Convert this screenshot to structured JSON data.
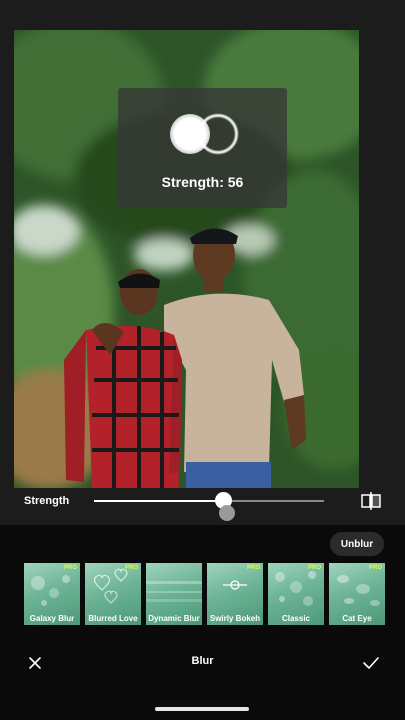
{
  "popup": {
    "strength_text": "Strength: 56"
  },
  "slider": {
    "label": "Strength",
    "value": 56,
    "max": 100
  },
  "unblur_label": "Unblur",
  "effects": [
    {
      "label": "Galaxy Blur",
      "pro": "PRO"
    },
    {
      "label": "Blurred Love",
      "pro": "PRO"
    },
    {
      "label": "Dynamic Blur",
      "pro": ""
    },
    {
      "label": "Swirly Bokeh",
      "pro": "PRO"
    },
    {
      "label": "Classic",
      "pro": "PRO"
    },
    {
      "label": "Cat Eye",
      "pro": "PRO"
    }
  ],
  "bottom_bar": {
    "title": "Blur"
  },
  "colors": {
    "background": "#0a0a0a",
    "panel": "#1c1c1c",
    "effect_tile": "#6eb497",
    "pro_badge": "#d9ff4a"
  },
  "icons": {
    "close": "close-icon",
    "confirm": "check-icon",
    "compare": "compare-icon"
  }
}
